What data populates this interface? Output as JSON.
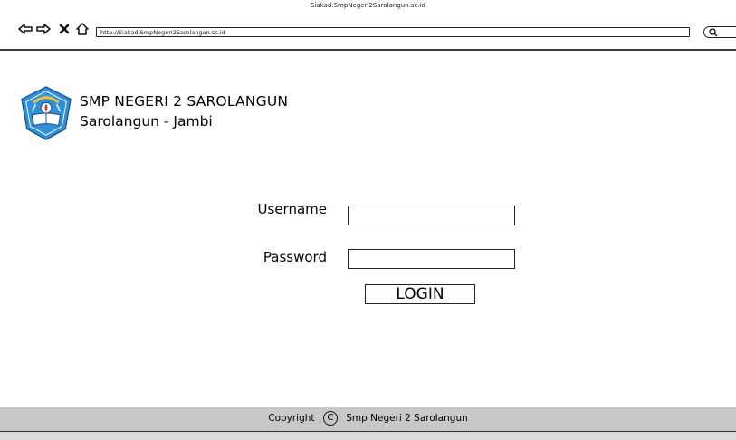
{
  "browser": {
    "window_title": "Siakad.SmpNegeri2Sarolangun.sc.id",
    "url": "http://Siakad.SmpNegeri2Sarolangun.sc.id"
  },
  "header": {
    "school_name": "SMP NEGERI 2 SAROLANGUN",
    "location": "Sarolangun - Jambi"
  },
  "login_form": {
    "username_label": "Username",
    "username_value": "",
    "password_label": "Password",
    "password_value": "",
    "login_button_label": "LOGIN"
  },
  "footer": {
    "copyright_label": "Copyright",
    "copyright_symbol": "C",
    "owner": "Smp Negeri 2 Sarolangun"
  },
  "colors": {
    "footer_background": "#c8c8c8",
    "logo_blue": "#2f8fd8",
    "border": "#222222"
  },
  "icons": [
    "back-arrow-icon",
    "forward-arrow-icon",
    "close-icon",
    "home-icon",
    "search-icon",
    "copyright-icon"
  ]
}
